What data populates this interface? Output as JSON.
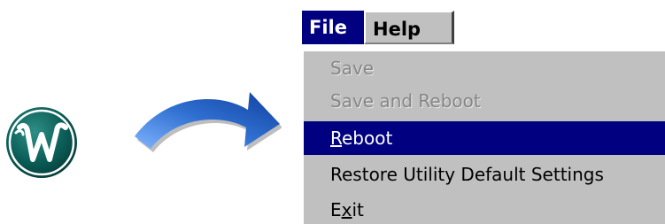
{
  "menubar": {
    "file_label": "File",
    "help_label": "Help"
  },
  "file_menu": {
    "items": [
      {
        "label": "Save",
        "state": "disabled"
      },
      {
        "label": "Save and Reboot",
        "state": "disabled"
      },
      {
        "label": "Reboot",
        "state": "highlighted",
        "mnemonic": "R",
        "rest": "eboot"
      },
      {
        "label": "Restore Utility Default Settings",
        "state": "enabled"
      },
      {
        "label": "Exit",
        "state": "enabled",
        "pre": "E",
        "mnemonic": "x",
        "rest": "it"
      }
    ]
  },
  "icons": {
    "app_logo": "w-emblem-icon",
    "arrow": "curved-arrow-icon"
  },
  "colors": {
    "highlight": "#000080",
    "menu_bg": "#c0c0c0",
    "disabled_text": "#868686",
    "logo_teal": "#0b5e58",
    "arrow_blue": "#2f6fd0"
  }
}
